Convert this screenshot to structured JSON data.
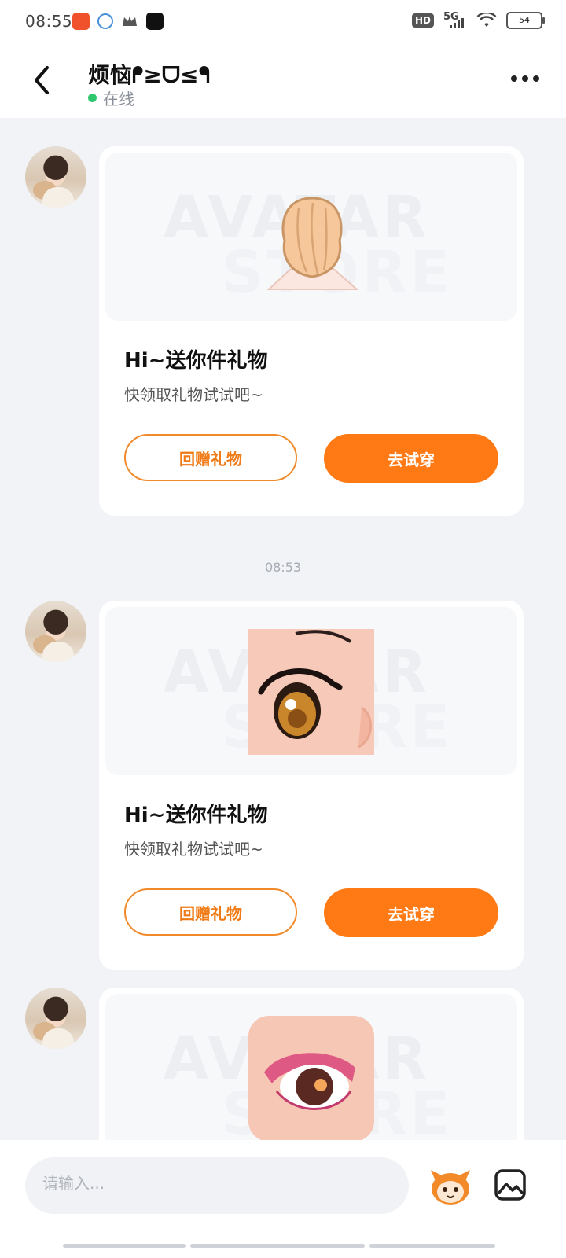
{
  "status_bar": {
    "time": "08:55",
    "network": "5G",
    "hd": "HD",
    "battery": "54"
  },
  "header": {
    "contact_name": "烦恼ᖰ≥ᗜ≤ᖳ",
    "status": "在线"
  },
  "messages": [
    {
      "timestamp": "",
      "title": "Hi~送你件礼物",
      "subtitle": "快领取礼物试试吧~",
      "btn_return": "回赠礼物",
      "btn_try": "去试穿",
      "preview_item": "hair-item"
    },
    {
      "timestamp": "08:53",
      "title": "Hi~送你件礼物",
      "subtitle": "快领取礼物试试吧~",
      "btn_return": "回赠礼物",
      "btn_try": "去试穿",
      "preview_item": "eye-item"
    },
    {
      "timestamp": "",
      "preview_item": "eye-makeup-item"
    }
  ],
  "watermark": {
    "line1": "AVATAR",
    "line2": "STORE"
  },
  "input": {
    "placeholder": "请输入..."
  },
  "colors": {
    "accent": "#ff7a14",
    "online": "#2fc76d",
    "background": "#f1f3f6"
  }
}
